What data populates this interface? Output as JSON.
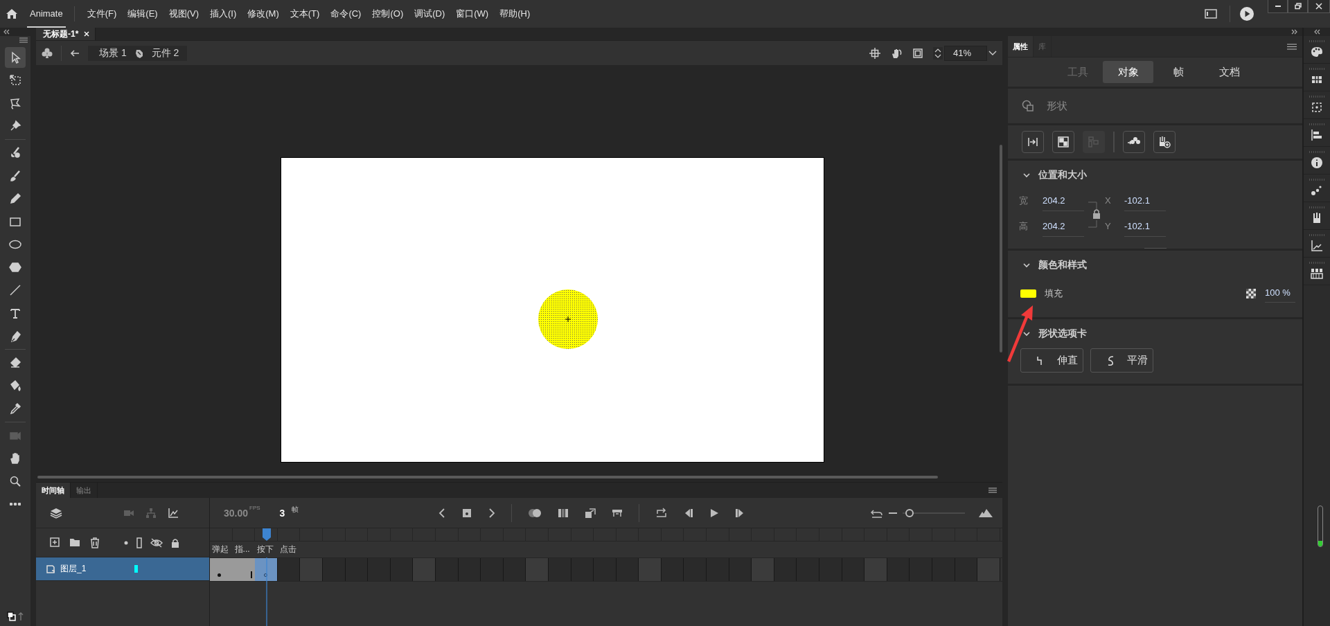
{
  "menu_bar": {
    "app_name": "Animate",
    "items": [
      "文件(F)",
      "编辑(E)",
      "视图(V)",
      "插入(I)",
      "修改(M)",
      "文本(T)",
      "命令(C)",
      "控制(O)",
      "调试(D)",
      "窗口(W)",
      "帮助(H)"
    ]
  },
  "document_tabs": [
    {
      "label": "无标题-1*",
      "selected": true
    }
  ],
  "tools": [
    {
      "kind": "selection",
      "selected": true,
      "disabled": false
    },
    {
      "kind": "free-transform",
      "selected": false,
      "disabled": false
    },
    {
      "kind": "lasso",
      "selected": false,
      "disabled": false
    },
    {
      "kind": "pin",
      "selected": false,
      "disabled": false
    },
    {
      "kind": "paint-brush",
      "selected": false,
      "disabled": false
    },
    {
      "kind": "brush",
      "selected": false,
      "disabled": false
    },
    {
      "kind": "pencil",
      "selected": false,
      "disabled": false
    },
    {
      "kind": "rectangle",
      "selected": false,
      "disabled": false
    },
    {
      "kind": "oval",
      "selected": false,
      "disabled": false
    },
    {
      "kind": "polystar",
      "selected": false,
      "disabled": false
    },
    {
      "kind": "line",
      "selected": false,
      "disabled": false
    },
    {
      "kind": "text",
      "selected": false,
      "disabled": false
    },
    {
      "kind": "pen",
      "selected": false,
      "disabled": false
    },
    {
      "kind": "eraser",
      "selected": false,
      "disabled": false
    },
    {
      "kind": "paint-bucket",
      "selected": false,
      "disabled": false
    },
    {
      "kind": "eyedropper",
      "selected": false,
      "disabled": false
    },
    {
      "kind": "camera",
      "selected": false,
      "disabled": true
    },
    {
      "kind": "hand",
      "selected": false,
      "disabled": false
    },
    {
      "kind": "zoom",
      "selected": false,
      "disabled": false
    },
    {
      "kind": "more",
      "selected": false,
      "disabled": false
    }
  ],
  "stage_header": {
    "breadcrumbs": [
      {
        "kind": "scene",
        "label": "场景 1"
      },
      {
        "kind": "symbol",
        "label": "元件 2"
      }
    ],
    "zoom": "41%"
  },
  "properties": {
    "panel_tabs": [
      {
        "label": "属性",
        "selected": true
      },
      {
        "label": "库",
        "selected": false
      }
    ],
    "mode_tabs": [
      {
        "label": "工具",
        "selected": false,
        "disabled": true
      },
      {
        "label": "对象",
        "selected": true,
        "disabled": false
      },
      {
        "label": "帧",
        "selected": false,
        "disabled": false
      },
      {
        "label": "文档",
        "selected": false,
        "disabled": false
      }
    ],
    "object_type": "形状",
    "position_size": {
      "title": "位置和大小",
      "expanded": true,
      "fields": [
        {
          "label": "宽",
          "value": "204.2"
        },
        {
          "label": "X",
          "value": "-102.1"
        },
        {
          "label": "高",
          "value": "204.2"
        },
        {
          "label": "Y",
          "value": "-102.1"
        }
      ]
    },
    "color_style": {
      "title": "颜色和样式",
      "expanded": true,
      "fill": {
        "label": "填充",
        "color": "#ffff00"
      },
      "alpha": "100 %"
    },
    "shape_options": {
      "title": "形状选项卡",
      "expanded": true,
      "buttons": [
        {
          "kind": "straighten",
          "label": "伸直"
        },
        {
          "kind": "smooth",
          "label": "平滑"
        }
      ]
    }
  },
  "timeline": {
    "tabs": [
      {
        "label": "时间轴",
        "selected": true
      },
      {
        "label": "输出",
        "selected": false
      }
    ],
    "fps": "30.00",
    "fps_unit": "FPS",
    "current_frame": "3",
    "frame_unit": "帧",
    "zoom_slider": {
      "level": 0.05
    },
    "frame_labels": [
      "弹起",
      "指...",
      "按下",
      "点击"
    ],
    "layers": [
      {
        "name": "图层_1",
        "selected": true,
        "color": "#00ffff",
        "frames": [
          {
            "kind": "keyframe",
            "selected": false
          },
          {
            "kind": "span-end",
            "selected": false
          },
          {
            "kind": "blank-keyframe",
            "selected": true
          }
        ]
      }
    ]
  }
}
